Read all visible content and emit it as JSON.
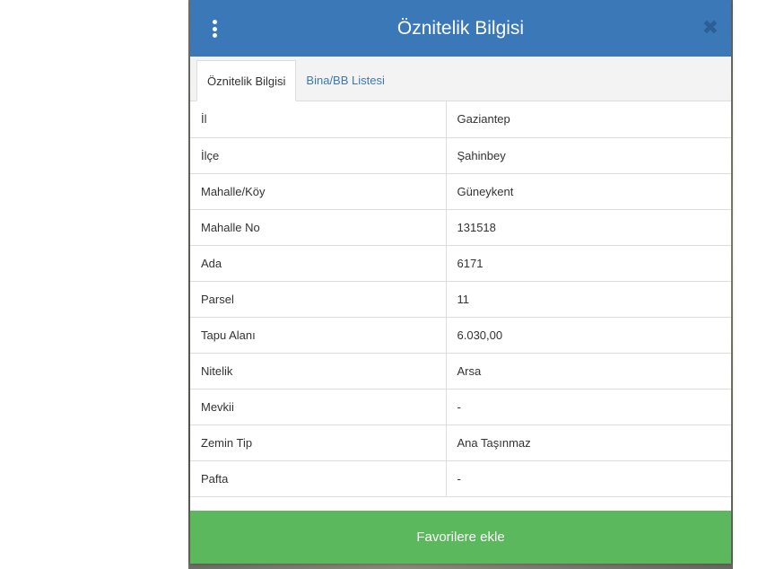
{
  "dialog": {
    "title": "Öznitelik Bilgisi",
    "close_glyph": "✖",
    "menu_icon": "vertical-ellipsis-icon",
    "close_icon": "close-icon"
  },
  "tabs": [
    {
      "label": "Öznitelik Bilgisi",
      "active": true
    },
    {
      "label": "Bina/BB Listesi",
      "active": false
    }
  ],
  "attributes": [
    {
      "key": "İl",
      "value": "Gaziantep"
    },
    {
      "key": "İlçe",
      "value": "Şahinbey"
    },
    {
      "key": "Mahalle/Köy",
      "value": "Güneykent"
    },
    {
      "key": "Mahalle No",
      "value": "131518"
    },
    {
      "key": "Ada",
      "value": "6171"
    },
    {
      "key": "Parsel",
      "value": "11"
    },
    {
      "key": "Tapu Alanı",
      "value": "6.030,00"
    },
    {
      "key": "Nitelik",
      "value": "Arsa"
    },
    {
      "key": "Mevkii",
      "value": "-"
    },
    {
      "key": "Zemin Tip",
      "value": "Ana Taşınmaz"
    },
    {
      "key": "Pafta",
      "value": "-"
    }
  ],
  "footer": {
    "favorite_label": "Favorilere ekle"
  },
  "colors": {
    "header": "#3a78b8",
    "favorite_button": "#5cb85c",
    "tab_link": "#3a78b8"
  }
}
